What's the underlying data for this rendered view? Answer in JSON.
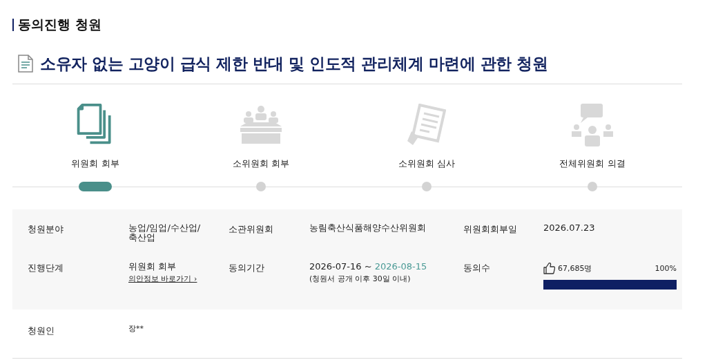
{
  "section_title": "동의진행 청원",
  "petition_title": "소유자 없는 고양이 급식 제한 반대 및 인도적 관리체계 마련에 관한 청원",
  "steps": [
    {
      "label": "위원회 회부",
      "kind": "documents",
      "selected": true
    },
    {
      "label": "소위원회 회부",
      "kind": "meeting",
      "selected": false
    },
    {
      "label": "소위원회 심사",
      "kind": "review",
      "selected": false
    },
    {
      "label": "전체위원회 의결",
      "kind": "plenary",
      "selected": false
    }
  ],
  "info": {
    "field": {
      "label": "청원분야",
      "lines": [
        "농업/임업/수산업/",
        "축산업"
      ]
    },
    "committee": {
      "label": "소관위원회",
      "value": "농림축산식품해양수산위원회"
    },
    "referral_date": {
      "label": "위원회회부일",
      "value": "2026.07.23"
    },
    "stage": {
      "label": "진행단계",
      "value": "위원회 회부",
      "link": "의안정보 바로가기",
      "link_arrow": "›"
    },
    "period": {
      "label": "동의기간",
      "start": "2026-07-16",
      "separator": "~",
      "end": "2026-08-15",
      "note": "(청원서 공개 이후 30일 이내)"
    },
    "agree": {
      "label": "동의수",
      "count": "67,685명",
      "percent": "100%",
      "level": 1.0
    },
    "petitioner": {
      "label": "청원인",
      "value": "장**"
    }
  }
}
